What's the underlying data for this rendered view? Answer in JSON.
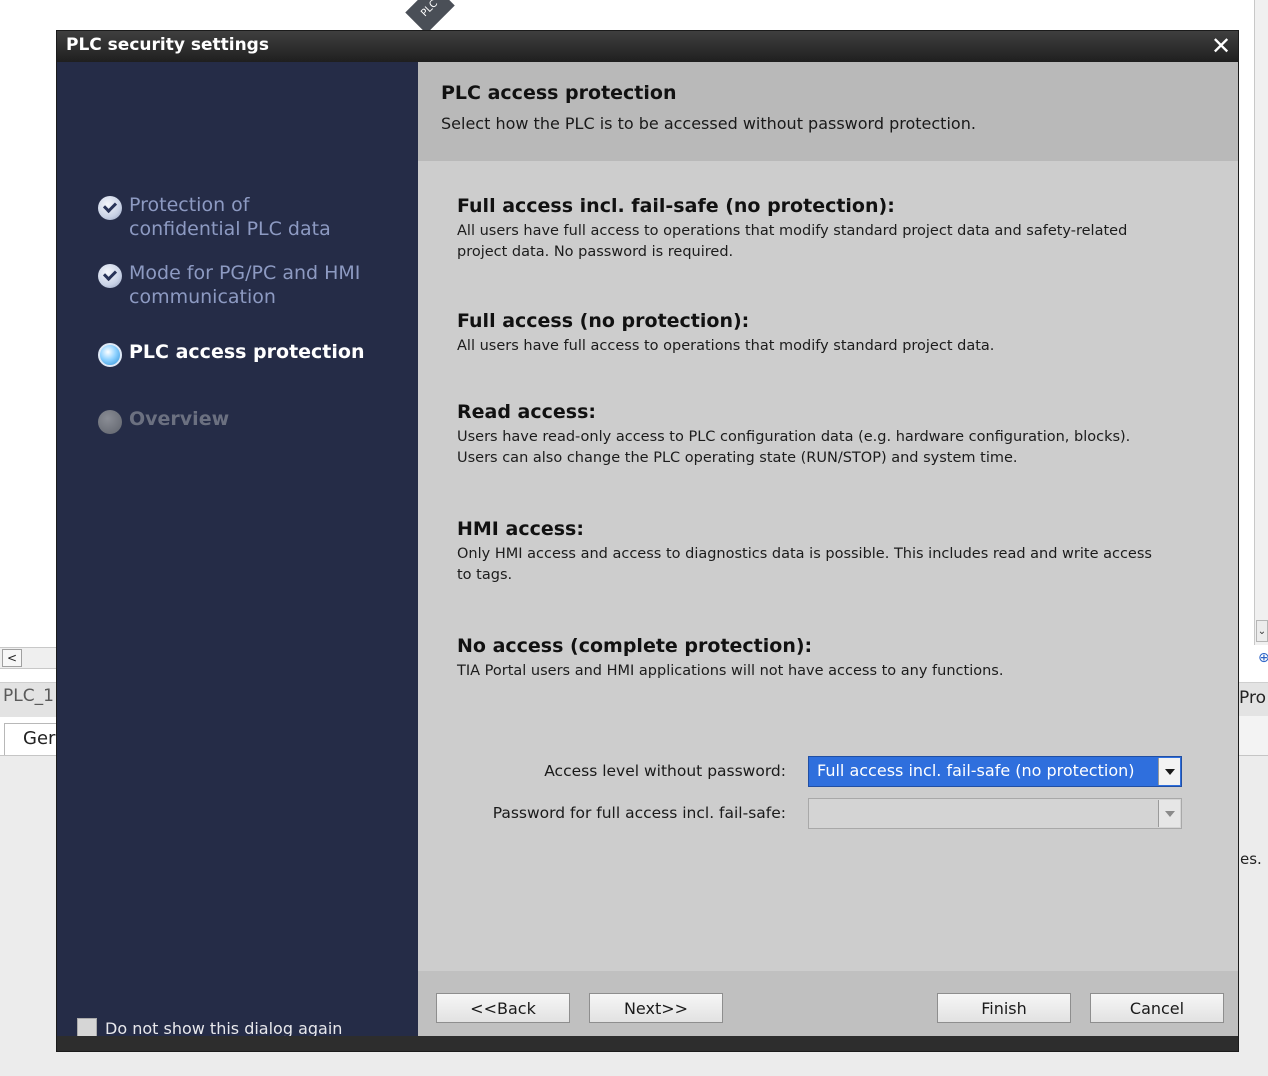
{
  "background": {
    "plc_label": "PLC_1",
    "tab_label": "Ger",
    "pro_label": "Pro",
    "es_text": "es."
  },
  "dialog": {
    "title": "PLC security settings",
    "close_glyph": "✕",
    "steps": [
      {
        "label_line1": "Protection of",
        "label_line2": "confidential PLC data",
        "state": "done"
      },
      {
        "label_line1": "Mode for PG/PC and HMI",
        "label_line2": "communication",
        "state": "done"
      },
      {
        "label_line1": "PLC access protection",
        "label_line2": "",
        "state": "current"
      },
      {
        "label_line1": "Overview",
        "label_line2": "",
        "state": "pending"
      }
    ],
    "dont_show_label": "Do not show this dialog again",
    "header": {
      "title": "PLC access protection",
      "subtitle": "Select how the PLC is to be accessed without password protection."
    },
    "options": [
      {
        "title": "Full access incl. fail-safe (no protection):",
        "desc1": "All users have full access to operations that modify standard project data and safety-related",
        "desc2": "project data. No password is required."
      },
      {
        "title": "Full access (no protection):",
        "desc1": "All users have full access to operations that modify standard project data.",
        "desc2": ""
      },
      {
        "title": "Read access:",
        "desc1": "Users have read-only access to PLC configuration data (e.g. hardware configuration, blocks).",
        "desc2": "Users can also change the PLC operating state (RUN/STOP) and system time."
      },
      {
        "title": "HMI access:",
        "desc1": "Only HMI access and access to diagnostics data is possible. This includes read and write access",
        "desc2": "to tags."
      },
      {
        "title": "No access (complete protection):",
        "desc1": "TIA Portal users and HMI applications will not have access to any functions.",
        "desc2": ""
      }
    ],
    "form": {
      "access_level_label": "Access level without password:",
      "access_level_value": "Full access incl. fail-safe (no protection)",
      "password_label": "Password for full access incl. fail-safe:",
      "password_value": ""
    },
    "buttons": {
      "back": "<<Back",
      "next": "Next>>",
      "finish": "Finish",
      "cancel": "Cancel"
    }
  }
}
